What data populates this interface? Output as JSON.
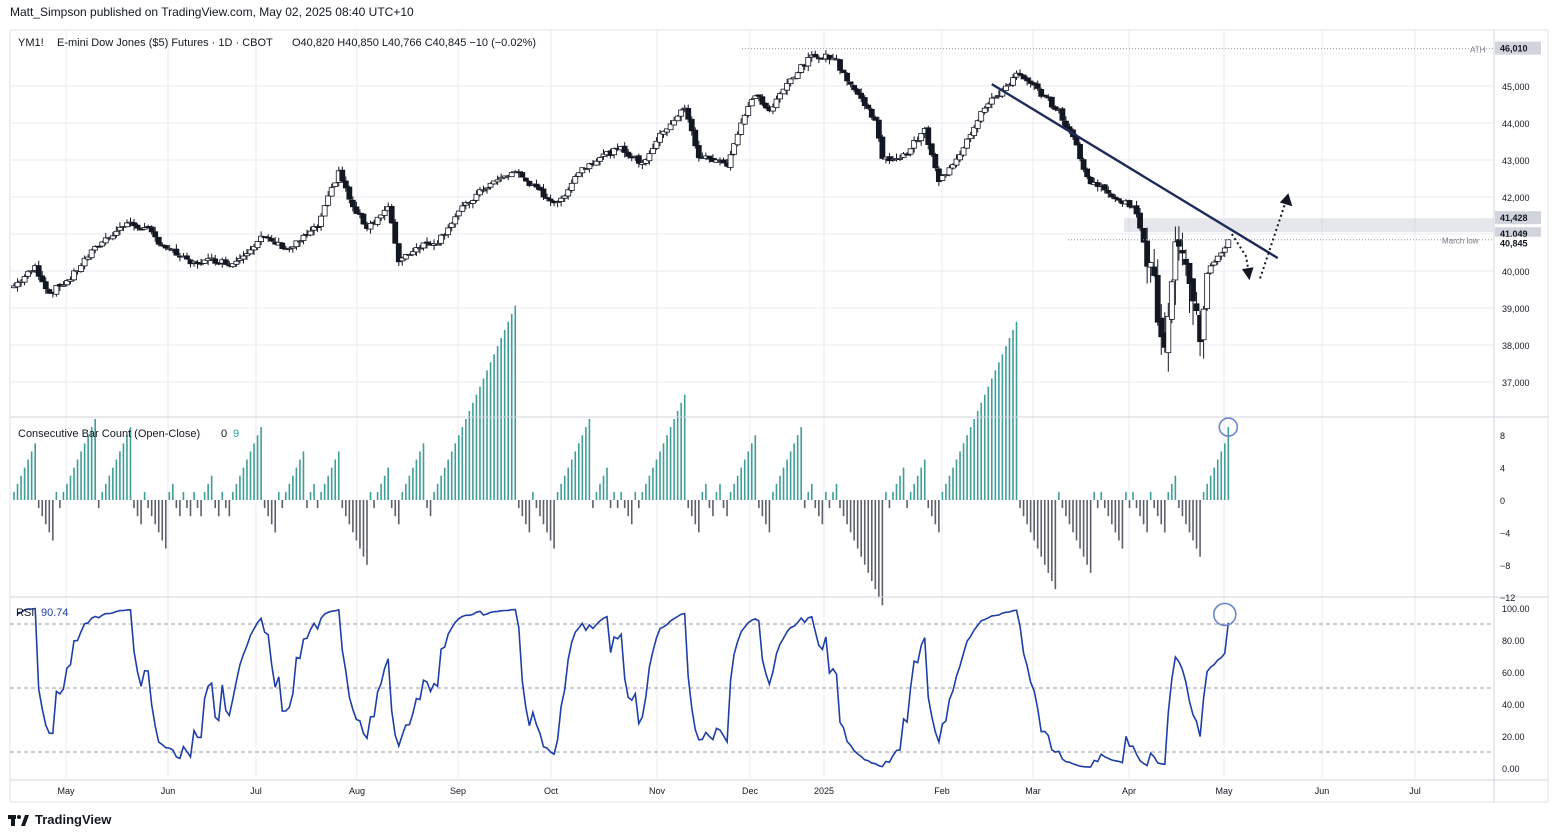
{
  "header": {
    "published": "Matt_Simpson published on TradingView.com, May 02, 2025 08:40 UTC+10"
  },
  "symbol": {
    "name": "YM1!",
    "description": "E-mini Dow Jones ($5) Futures · 1D · CBOT",
    "ohlc": "O40,820  H40,850  L40,766  C40,845  −10 (−0.02%)"
  },
  "footer": {
    "brand": "TradingView"
  },
  "colors": {
    "up": "#26a69a",
    "down": "#131722",
    "rsi": "#1f3fa8",
    "trend": "#1e2a5a",
    "zone": "#d1d4dc",
    "grid": "#e9ebf0",
    "cbc_up": "#3f9e97",
    "cbc_down": "#5d606b",
    "highlight": "#6b86c9"
  },
  "chart_data": [
    {
      "type": "candlestick",
      "title": "YM1! · E-mini Dow Jones ($5) Futures · 1D · CBOT",
      "x_labels": [
        "May",
        "Jun",
        "Jul",
        "Aug",
        "Sep",
        "Oct",
        "Nov",
        "Dec",
        "2025",
        "Feb",
        "Mar",
        "Apr",
        "May",
        "Jun",
        "Jul"
      ],
      "y_ticks": [
        37000,
        38000,
        39000,
        40000,
        41000,
        42000,
        43000,
        44000,
        45000
      ],
      "ylim": [
        36500,
        46400
      ],
      "close_path": [
        [
          0,
          39600
        ],
        [
          6,
          40100
        ],
        [
          10,
          39400
        ],
        [
          16,
          39800
        ],
        [
          20,
          40300
        ],
        [
          25,
          40800
        ],
        [
          32,
          41300
        ],
        [
          38,
          41100
        ],
        [
          42,
          40700
        ],
        [
          50,
          40200
        ],
        [
          56,
          40300
        ],
        [
          62,
          40200
        ],
        [
          70,
          40900
        ],
        [
          78,
          40600
        ],
        [
          86,
          41200
        ],
        [
          92,
          42700
        ],
        [
          96,
          41700
        ],
        [
          100,
          41200
        ],
        [
          106,
          41700
        ],
        [
          109,
          40300
        ],
        [
          115,
          40700
        ],
        [
          120,
          40800
        ],
        [
          126,
          41600
        ],
        [
          134,
          42300
        ],
        [
          142,
          42700
        ],
        [
          148,
          42200
        ],
        [
          154,
          41800
        ],
        [
          160,
          42700
        ],
        [
          166,
          43100
        ],
        [
          172,
          43300
        ],
        [
          178,
          42900
        ],
        [
          184,
          43800
        ],
        [
          190,
          44400
        ],
        [
          194,
          43100
        ],
        [
          202,
          42900
        ],
        [
          206,
          44000
        ],
        [
          210,
          44800
        ],
        [
          214,
          44300
        ],
        [
          220,
          45200
        ],
        [
          226,
          45800
        ],
        [
          232,
          45800
        ],
        [
          238,
          44900
        ],
        [
          244,
          44100
        ],
        [
          246,
          43000
        ],
        [
          252,
          43100
        ],
        [
          258,
          43800
        ],
        [
          262,
          42400
        ],
        [
          268,
          43200
        ],
        [
          274,
          44300
        ],
        [
          280,
          44900
        ],
        [
          284,
          45300
        ],
        [
          290,
          44900
        ],
        [
          296,
          44300
        ],
        [
          301,
          43400
        ],
        [
          304,
          42500
        ],
        [
          312,
          42000
        ],
        [
          314,
          41900
        ],
        [
          318,
          41600
        ],
        [
          322,
          40100
        ],
        [
          324,
          38900
        ],
        [
          326,
          37700
        ],
        [
          329,
          40400
        ],
        [
          333,
          39800
        ],
        [
          336,
          38400
        ],
        [
          338,
          39900
        ],
        [
          340,
          40300
        ],
        [
          342,
          40500
        ],
        [
          344,
          40845
        ]
      ],
      "total_bars": 345,
      "annotations": {
        "ath": 46010,
        "march_low": 40845,
        "zone": [
          41049,
          41428
        ]
      },
      "price_labels": [
        "46,010",
        "41,428",
        "41,049",
        "40,845"
      ],
      "ath_label": "ATH",
      "march_low_label": "March low"
    },
    {
      "type": "bar",
      "title": "Consecutive Bar Count (Open-Close)",
      "value_labels": [
        "0",
        "9"
      ],
      "y_ticks": [
        -12,
        -8,
        -4,
        0,
        4,
        8
      ],
      "ylim": [
        -12,
        10
      ],
      "last_value": 9
    },
    {
      "type": "line",
      "title": "RSI",
      "value_label": "90.74",
      "y_ticks": [
        0,
        20,
        40,
        60,
        80,
        100
      ],
      "ylim": [
        -3,
        101
      ],
      "dashed_levels": [
        10,
        50,
        90
      ],
      "last_value": 90.74
    }
  ]
}
